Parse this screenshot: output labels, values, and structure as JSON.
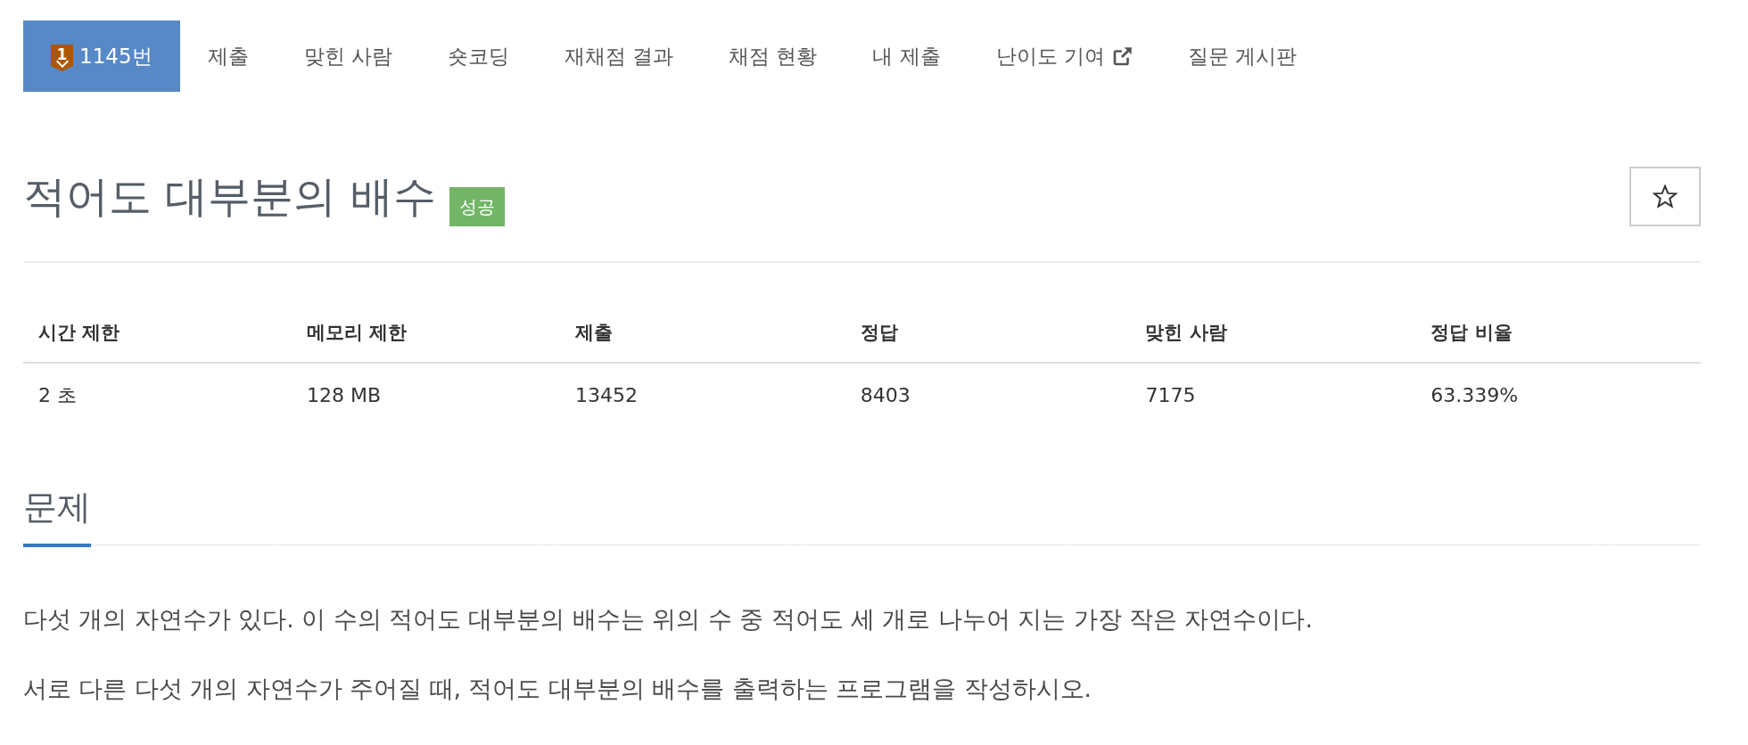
{
  "nav": {
    "tabs": [
      {
        "label": "1145번",
        "badge": "1",
        "selected": true,
        "external": false
      },
      {
        "label": "제출",
        "selected": false,
        "external": false
      },
      {
        "label": "맞힌 사람",
        "selected": false,
        "external": false
      },
      {
        "label": "숏코딩",
        "selected": false,
        "external": false
      },
      {
        "label": "재채점 결과",
        "selected": false,
        "external": false
      },
      {
        "label": "채점 현황",
        "selected": false,
        "external": false
      },
      {
        "label": "내 제출",
        "selected": false,
        "external": false
      },
      {
        "label": "난이도 기여",
        "selected": false,
        "external": true
      },
      {
        "label": "질문 게시판",
        "selected": false,
        "external": false
      }
    ]
  },
  "problem": {
    "title": "적어도 대부분의 배수",
    "result": {
      "label": "성공",
      "kind": "accepted"
    },
    "starred": false
  },
  "stats": {
    "columns": [
      "시간 제한",
      "메모리 제한",
      "제출",
      "정답",
      "맞힌 사람",
      "정답 비율"
    ],
    "rows": [
      [
        "2 초",
        "128 MB",
        "13452",
        "8403",
        "7175",
        "63.339%"
      ]
    ]
  },
  "sections": [
    {
      "heading": "문제",
      "paragraphs": [
        "다섯 개의 자연수가 있다. 이 수의 적어도 대부분의 배수는 위의 수 중 적어도 세 개로 나누어 지는 가장 작은 자연수이다.",
        "서로 다른 다섯 개의 자연수가 주어질 때, 적어도 대부분의 배수를 출력하는 프로그램을 작성하시오."
      ]
    }
  ]
}
